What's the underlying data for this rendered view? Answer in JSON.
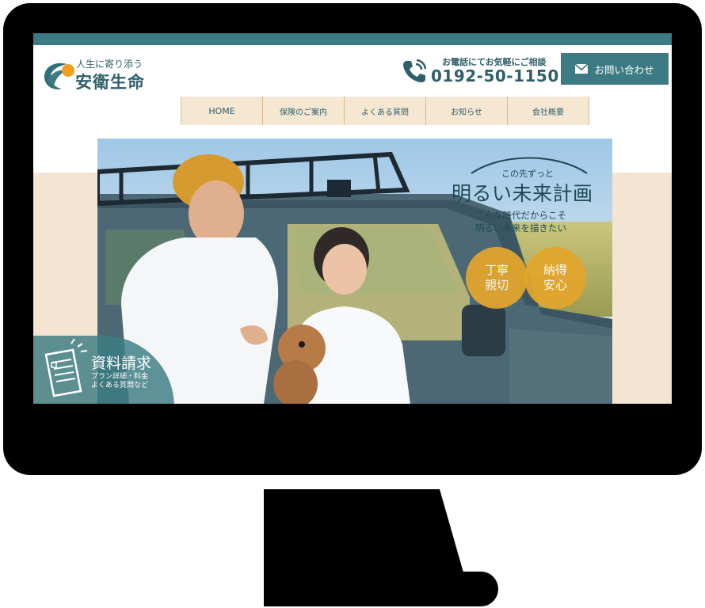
{
  "header": {
    "tagline": "人生に寄り添う",
    "company": "安衛生命",
    "phone_lead": "お電話にてお気軽にご相談",
    "phone_number": "0192-50-1150",
    "contact_button": "お問い合わせ"
  },
  "nav": {
    "items": [
      {
        "label": "HOME"
      },
      {
        "label": "保険のご案内"
      },
      {
        "label": "よくある質問"
      },
      {
        "label": "お知らせ"
      },
      {
        "label": "会社概要"
      }
    ]
  },
  "hero": {
    "lead": "この先ずっと",
    "title": "明るい未来計画",
    "sub_line1": "こんな時代だからこそ",
    "sub_line2": "明るい未来を描きたい",
    "badges": [
      {
        "line1": "丁寧",
        "line2": "親切"
      },
      {
        "line1": "納得",
        "line2": "安心"
      }
    ]
  },
  "doc_request": {
    "title": "資料請求",
    "line1": "プラン詳細・料金",
    "line2": "よくある質問など"
  },
  "colors": {
    "brand_teal": "#3c7b83",
    "nav_beige": "#f5e7d2",
    "badge_gold": "#e3a62c",
    "logo_orange": "#f0a020"
  },
  "icons": [
    "phone-icon",
    "envelope-icon",
    "document-icon",
    "logo-mark"
  ]
}
